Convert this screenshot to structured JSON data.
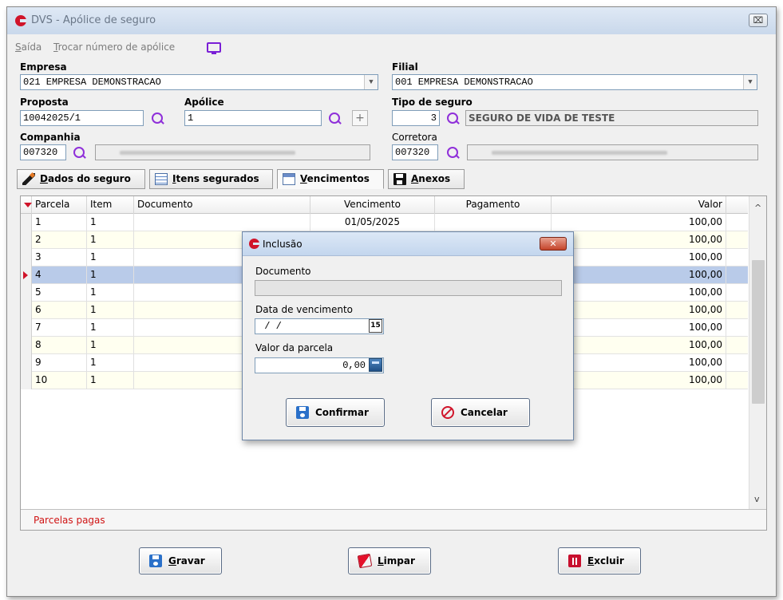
{
  "window": {
    "title": "DVS - Apólice de seguro",
    "close_glyph": "⌧"
  },
  "menu": {
    "items": [
      {
        "key": "S",
        "rest": "aída"
      },
      {
        "key": "T",
        "rest": "rocar número de apólice"
      }
    ]
  },
  "form": {
    "empresa": {
      "label": "Empresa",
      "value": "021 EMPRESA DEMONSTRACAO"
    },
    "filial": {
      "label": "Filial",
      "value": "001 EMPRESA DEMONSTRACAO"
    },
    "proposta": {
      "label": "Proposta",
      "value": "10042025/1"
    },
    "apolice": {
      "label": "Apólice",
      "value": "1",
      "plus": "+"
    },
    "tipo_seguro": {
      "label": "Tipo de seguro",
      "code": "3",
      "value": "SEGURO DE VIDA DE TESTE"
    },
    "companhia": {
      "label": "Companhia",
      "code": "007320"
    },
    "corretora": {
      "label": "Corretora",
      "code": "007320"
    }
  },
  "tabs": [
    {
      "key": "D",
      "rest": "ados do seguro"
    },
    {
      "key": "I",
      "rest": "tens segurados"
    },
    {
      "key": "V",
      "rest": "encimentos"
    },
    {
      "key": "A",
      "rest": "nexos"
    }
  ],
  "grid": {
    "headers": {
      "parcela": "Parcela",
      "item": "Item",
      "documento": "Documento",
      "vencimento": "Vencimento",
      "pagamento": "Pagamento",
      "valor": "Valor"
    },
    "rows": [
      {
        "parcela": "1",
        "item": "1",
        "vencimento": "01/05/2025",
        "valor": "100,00"
      },
      {
        "parcela": "2",
        "item": "1",
        "valor": "100,00"
      },
      {
        "parcela": "3",
        "item": "1",
        "valor": "100,00"
      },
      {
        "parcela": "4",
        "item": "1",
        "valor": "100,00"
      },
      {
        "parcela": "5",
        "item": "1",
        "valor": "100,00"
      },
      {
        "parcela": "6",
        "item": "1",
        "valor": "100,00"
      },
      {
        "parcela": "7",
        "item": "1",
        "valor": "100,00"
      },
      {
        "parcela": "8",
        "item": "1",
        "valor": "100,00"
      },
      {
        "parcela": "9",
        "item": "1",
        "valor": "100,00"
      },
      {
        "parcela": "10",
        "item": "1",
        "valor": "100,00"
      }
    ],
    "footer_note": "Parcelas pagas"
  },
  "buttons": {
    "gravar": {
      "key": "G",
      "rest": "ravar"
    },
    "limpar": {
      "key": "L",
      "rest": "impar"
    },
    "excluir": {
      "key": "E",
      "rest": "xcluir"
    }
  },
  "dialog": {
    "title": "Inclusão",
    "close_glyph": "✕",
    "documento_label": "Documento",
    "documento_value": "",
    "data_label": "Data de vencimento",
    "data_value": " / /",
    "cal_text": "15",
    "valor_label": "Valor da parcela",
    "valor_value": "0,00",
    "confirmar": "Confirmar",
    "cancelar": "Cancelar"
  },
  "colors": {
    "brand": "#d0142a",
    "accent_purple": "#8f2fd9",
    "selection": "#b9cbe9",
    "footer_text": "#d01414"
  }
}
